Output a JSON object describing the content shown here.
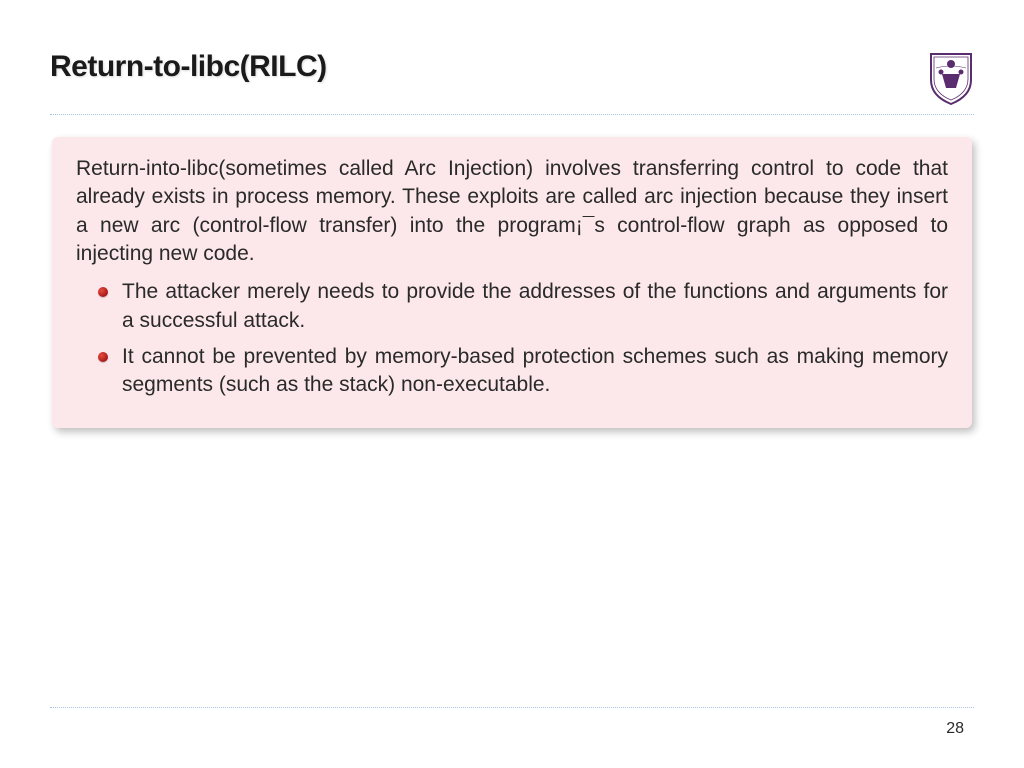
{
  "header": {
    "title": "Return-to-libc(RILC)"
  },
  "content": {
    "intro": "Return-into-libc(sometimes called Arc Injection) involves transferring control to code that already exists in process memory. These exploits are called arc injection because they insert a new arc (control-flow transfer) into the program¡¯s control-flow graph as opposed to injecting new code.",
    "bullets": [
      "The attacker merely needs to provide the addresses of the functions and arguments for a successful attack.",
      "It cannot be prevented by memory-based protection schemes such as making memory segments (such as the stack) non-executable."
    ]
  },
  "footer": {
    "page_number": "28"
  },
  "logo": {
    "name": "university-shield-logo"
  }
}
